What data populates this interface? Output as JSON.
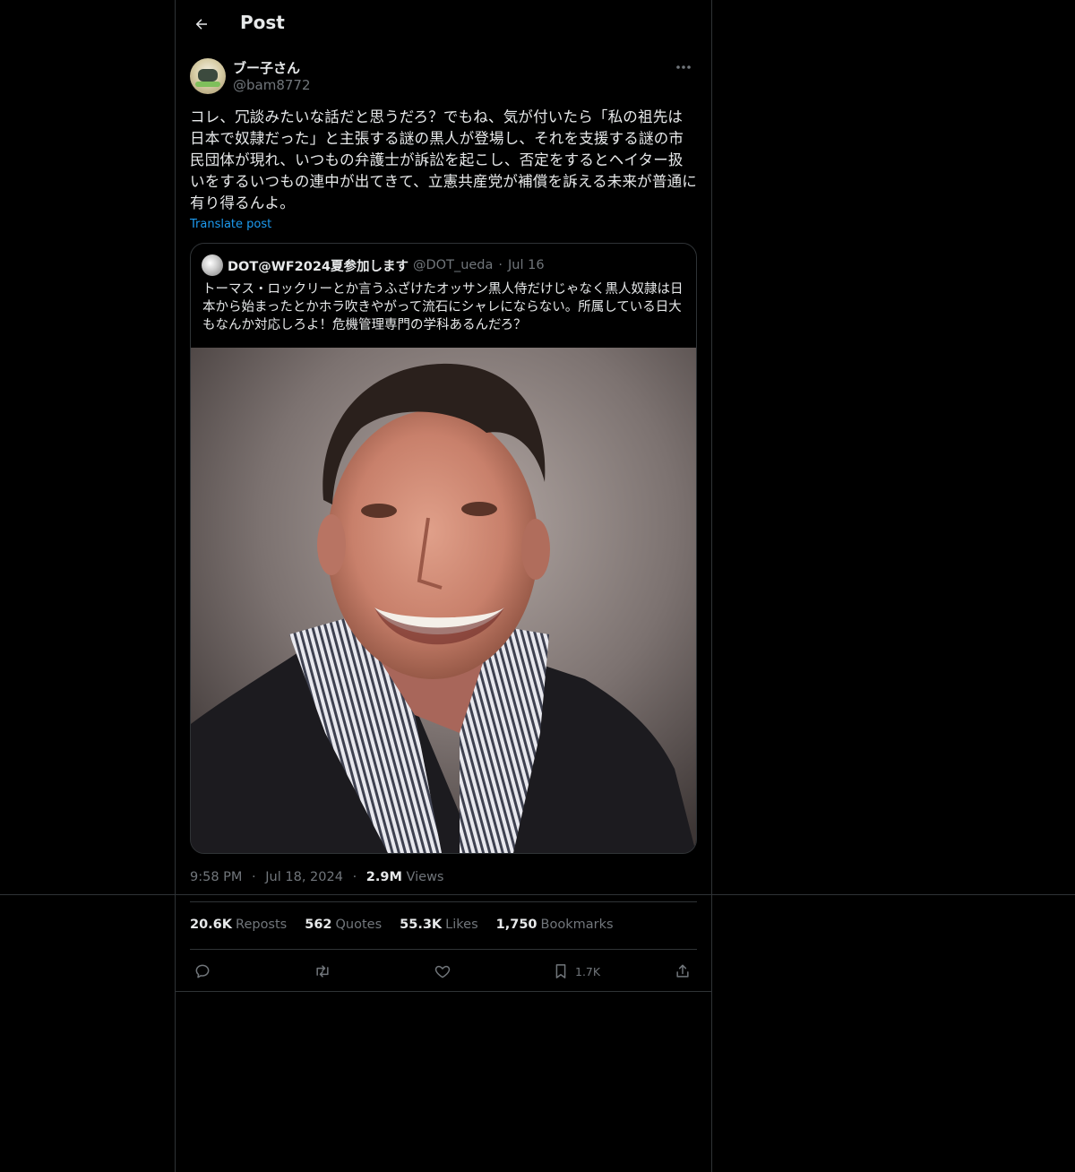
{
  "header": {
    "title": "Post"
  },
  "post": {
    "author": {
      "display_name": "ブー子さん",
      "handle": "@bam8772"
    },
    "text": "コレ、冗談みたいな話だと思うだろ？でもね、気が付いたら「私の祖先は日本で奴隷だった」と主張する謎の黒人が登場し、それを支援する謎の市民団体が現れ、いつもの弁護士が訴訟を起こし、否定をするとヘイター扱いをするいつもの連中が出てきて、立憲共産党が補償を訴える未来が普通に有り得るんよ。",
    "translate_label": "Translate post",
    "quote": {
      "display_name": "DOT@WF2024夏参加します",
      "handle": "@DOT_ueda",
      "dot": "·",
      "date": "Jul 16",
      "text": "トーマス・ロックリーとか言うふざけたオッサン黒人侍だけじゃなく黒人奴隷は日本から始まったとかホラ吹きやがって流石にシャレにならない。所属している日大もなんか対応しろよ！危機管理専門の学科あるんだろ？"
    },
    "time": "9:58 PM",
    "dot": "·",
    "date": "Jul 18, 2024",
    "views_count": "2.9M",
    "views_label": "Views"
  },
  "stats": {
    "reposts_count": "20.6K",
    "reposts_label": "Reposts",
    "quotes_count": "562",
    "quotes_label": "Quotes",
    "likes_count": "55.3K",
    "likes_label": "Likes",
    "bookmarks_count": "1,750",
    "bookmarks_label": "Bookmarks"
  },
  "actions": {
    "reply_icon": "reply-icon",
    "repost_icon": "repost-icon",
    "like_icon": "heart-icon",
    "bookmark_icon": "bookmark-icon",
    "bookmark_count": "1.7K",
    "share_icon": "share-icon"
  },
  "colors": {
    "background": "#000000",
    "border": "#2f3336",
    "text_primary": "#e7e9ea",
    "text_secondary": "#71767b",
    "link": "#1d9bf0"
  }
}
